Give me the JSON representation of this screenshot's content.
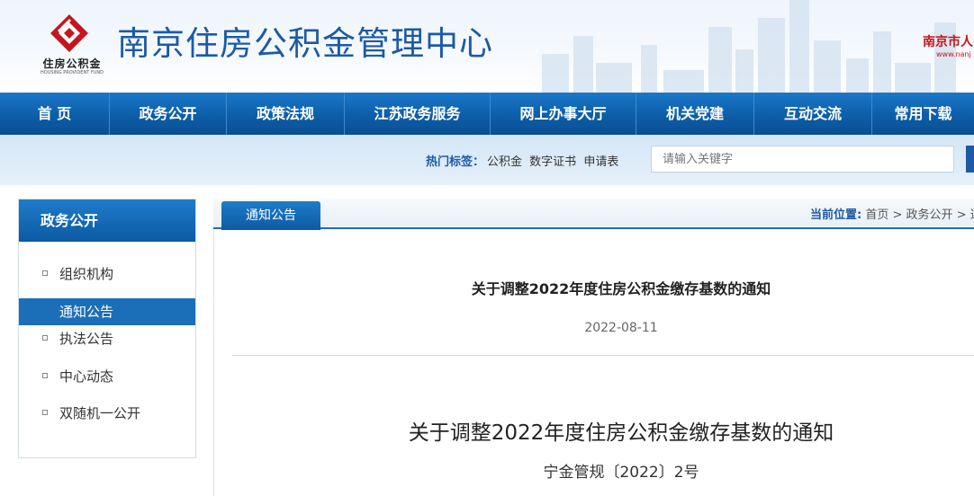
{
  "header": {
    "logo_text": "住房公积金",
    "logo_subtext": "HOUSING PROVIDENT FUND",
    "site_title": "南京住房公积金管理中心",
    "side_link": "南京市人",
    "side_link_sub": "www.nanj"
  },
  "nav": {
    "items": [
      {
        "label": "首 页"
      },
      {
        "label": "政务公开"
      },
      {
        "label": "政策法规"
      },
      {
        "label": "江苏政务服务"
      },
      {
        "label": "网上办事大厅"
      },
      {
        "label": "机关党建"
      },
      {
        "label": "互动交流"
      },
      {
        "label": "常用下载"
      }
    ]
  },
  "search": {
    "hot_label": "热门标签：",
    "hot_tags": [
      "公积金",
      "数字证书",
      "申请表"
    ],
    "placeholder": "请输入关键字"
  },
  "sidebar": {
    "title": "政务公开",
    "items": [
      {
        "label": "组织机构",
        "active": false
      },
      {
        "label": "通知公告",
        "active": true
      },
      {
        "label": "执法公告",
        "active": false
      },
      {
        "label": "中心动态",
        "active": false
      },
      {
        "label": "双随机一公开",
        "active": false
      }
    ]
  },
  "main": {
    "tab_label": "通知公告",
    "breadcrumb": {
      "label": "当前位置:",
      "home": "首页",
      "sep": ">",
      "section": "政务公开",
      "tail": "通"
    },
    "article": {
      "title": "关于调整2022年度住房公积金缴存基数的通知",
      "date": "2022-08-11",
      "body_title": "关于调整2022年度住房公积金缴存基数的通知",
      "doc_number": "宁金管规〔2022〕2号"
    }
  },
  "colors": {
    "brand_blue": "#1c5aa6",
    "nav_blue": "#0d5ea8",
    "logo_red": "#c4161c"
  }
}
